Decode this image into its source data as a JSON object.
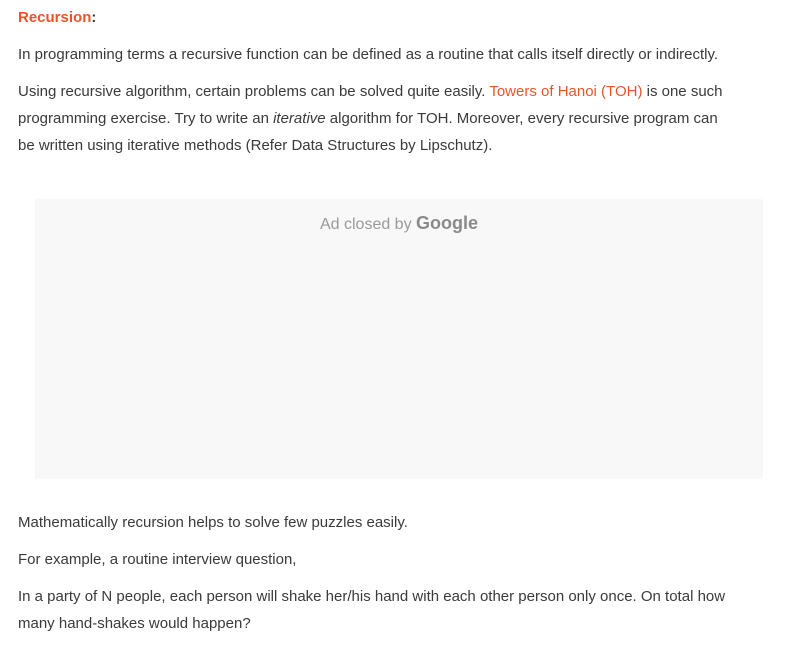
{
  "section": {
    "title": "Recursion",
    "title_suffix": ":"
  },
  "paragraphs": {
    "p1": "In programming terms a recursive function can be defined as a routine that calls itself directly or indirectly.",
    "p2_line1_before": "Using recursive algorithm, certain problems can be solved quite easily. ",
    "p2_link": "Towers of Hanoi (TOH)",
    "p2_line1_after": " is one such",
    "p2_line2_before": "programming exercise. Try to write an ",
    "p2_emphasis": "iterative",
    "p2_line2_after": " algorithm for TOH. Moreover, every recursive program can",
    "p2_line3": "be written using iterative methods (Refer Data Structures by Lipschutz).",
    "p3": "Mathematically recursion helps to solve few puzzles easily.",
    "p4": "For example, a routine interview question,",
    "p5_line1": "In a party of N people, each person will shake her/his hand with each other person only once. On total how",
    "p5_line2": "many hand-shakes would happen?"
  },
  "ad": {
    "label": "Ad closed by ",
    "brand": "Google"
  },
  "colors": {
    "accent": "#e8542c",
    "text": "#3a3a3a",
    "ad_background": "#f8f8f8"
  }
}
